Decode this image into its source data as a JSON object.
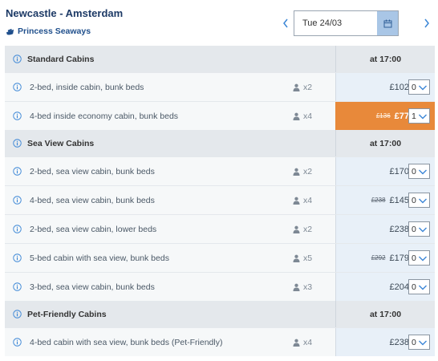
{
  "header": {
    "route_title": "Newcastle - Amsterdam",
    "operator": "Princess Seaways",
    "date_value": "Tue 24/03"
  },
  "colors": {
    "accent_blue": "#3b86d6",
    "highlight_orange": "#e8893a",
    "section_bg": "#e4e8ec"
  },
  "sections": [
    {
      "title": "Standard Cabins",
      "time": "at 17:00",
      "items": [
        {
          "desc": "2-bed, inside cabin, bunk beds",
          "occupancy": "x2",
          "old_price": "",
          "price": "£102",
          "qty": "0",
          "highlight": false
        },
        {
          "desc": "4-bed inside economy cabin, bunk beds",
          "occupancy": "x4",
          "old_price": "£136",
          "price": "£77",
          "qty": "1",
          "highlight": true
        }
      ]
    },
    {
      "title": "Sea View Cabins",
      "time": "at 17:00",
      "items": [
        {
          "desc": "2-bed, sea view cabin, bunk beds",
          "occupancy": "x2",
          "old_price": "",
          "price": "£170",
          "qty": "0",
          "highlight": false
        },
        {
          "desc": "4-bed, sea view cabin, bunk beds",
          "occupancy": "x4",
          "old_price": "£238",
          "price": "£145",
          "qty": "0",
          "highlight": false
        },
        {
          "desc": "2-bed, sea view cabin, lower beds",
          "occupancy": "x2",
          "old_price": "",
          "price": "£238",
          "qty": "0",
          "highlight": false
        },
        {
          "desc": "5-bed cabin with sea view, bunk beds",
          "occupancy": "x5",
          "old_price": "£292",
          "price": "£179",
          "qty": "0",
          "highlight": false
        },
        {
          "desc": "3-bed, sea view cabin, bunk beds",
          "occupancy": "x3",
          "old_price": "",
          "price": "£204",
          "qty": "0",
          "highlight": false
        }
      ]
    },
    {
      "title": "Pet-Friendly Cabins",
      "time": "at 17:00",
      "items": [
        {
          "desc": "4-bed cabin with sea view, bunk beds (Pet-Friendly)",
          "occupancy": "x4",
          "old_price": "",
          "price": "£238",
          "qty": "0",
          "highlight": false
        }
      ]
    }
  ]
}
